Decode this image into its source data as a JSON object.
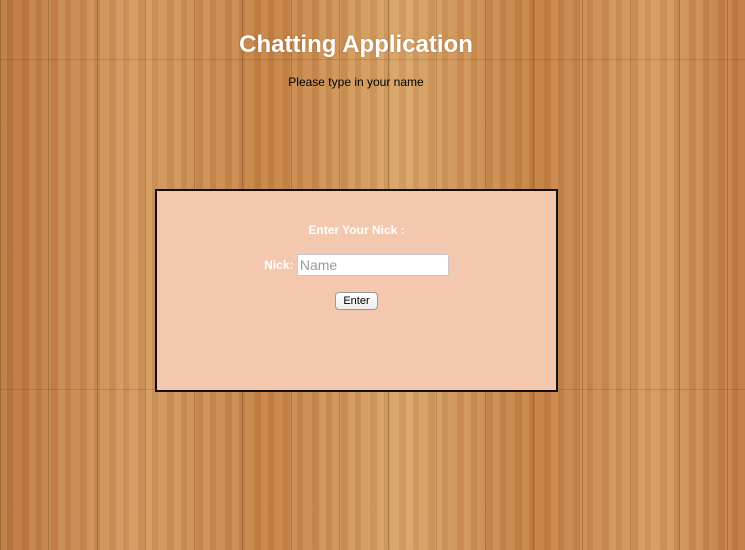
{
  "header": {
    "title": "Chatting Application",
    "subtitle": "Please type in your name"
  },
  "nick_form": {
    "heading": "Enter Your Nick :",
    "nick_label": "Nick:",
    "nick_placeholder": "Name",
    "nick_value": "",
    "enter_label": "Enter"
  },
  "colors": {
    "panel_background": "#f3c8ae",
    "panel_border": "#111111",
    "title_color": "#ffffff",
    "subtitle_color": "#000000"
  }
}
